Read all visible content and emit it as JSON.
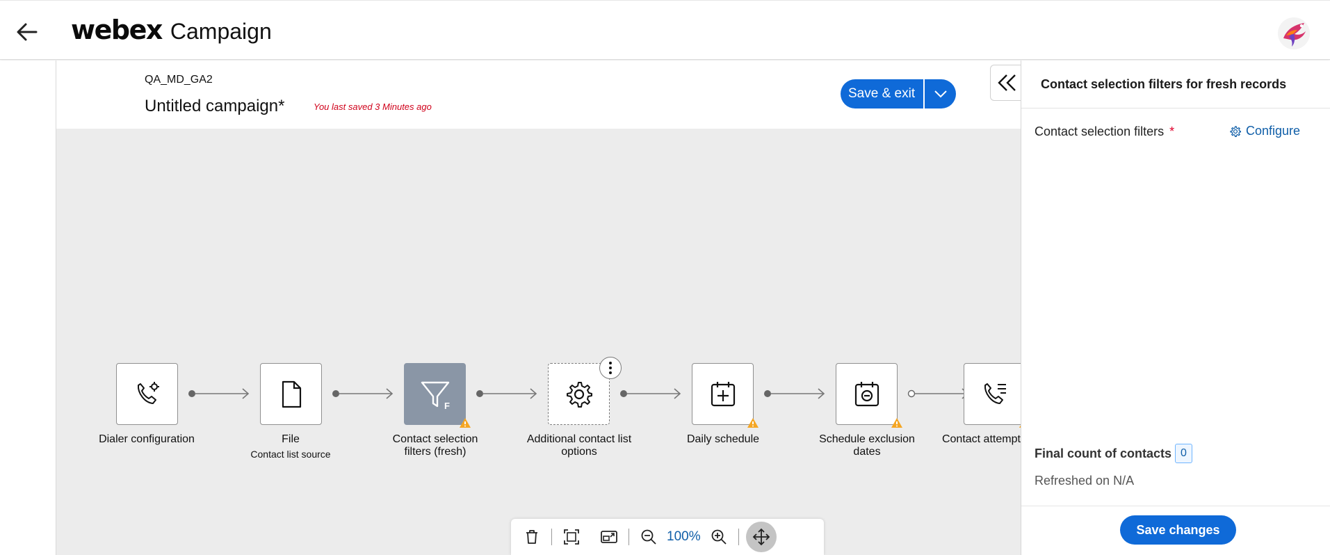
{
  "header": {
    "brand": "webex",
    "app_name": "Campaign"
  },
  "campaign": {
    "code": "QA_MD_GA2",
    "name": "Untitled campaign*",
    "saved_status": "You last saved 3 Minutes ago",
    "save_exit_label": "Save & exit"
  },
  "flow": {
    "nodes": [
      {
        "icon": "phone-settings-icon",
        "label": "Dialer configuration",
        "sublabel": "",
        "warning": false
      },
      {
        "icon": "file-icon",
        "label": "File",
        "sublabel": "Contact list source",
        "warning": false
      },
      {
        "icon": "filter-icon",
        "label": "Contact selection filters (fresh)",
        "sublabel": "",
        "badge": "F",
        "warning": true,
        "selected": true
      },
      {
        "icon": "gear-icon",
        "label": "Additional contact list options",
        "sublabel": "",
        "warning": false
      },
      {
        "icon": "calendar-add-icon",
        "label": "Daily schedule",
        "sublabel": "",
        "warning": true
      },
      {
        "icon": "calendar-minus-icon",
        "label": "Schedule exclusion dates",
        "sublabel": "",
        "warning": true
      },
      {
        "icon": "phone-list-icon",
        "label": "Contact attempts stra",
        "sublabel": "",
        "warning": true
      }
    ]
  },
  "toolbar": {
    "zoom": "100%",
    "icons": [
      "trash-icon",
      "fit-screen-icon",
      "minimap-icon",
      "zoom-out-icon",
      "zoom-in-icon",
      "pan-icon"
    ]
  },
  "panel": {
    "title": "Contact selection filters for fresh records",
    "filter_label": "Contact selection filters",
    "required_mark": "*",
    "configure_label": "Configure",
    "final_count_label": "Final count of contacts",
    "final_count_value": "0",
    "refreshed": "Refreshed on N/A",
    "save_changes_label": "Save changes"
  },
  "colors": {
    "primary": "#0f6ad8",
    "link": "#0f5ea8",
    "warning": "#f5a623",
    "error": "#d0021b",
    "canvas": "#ececec",
    "selected_node": "#8a96a6"
  }
}
